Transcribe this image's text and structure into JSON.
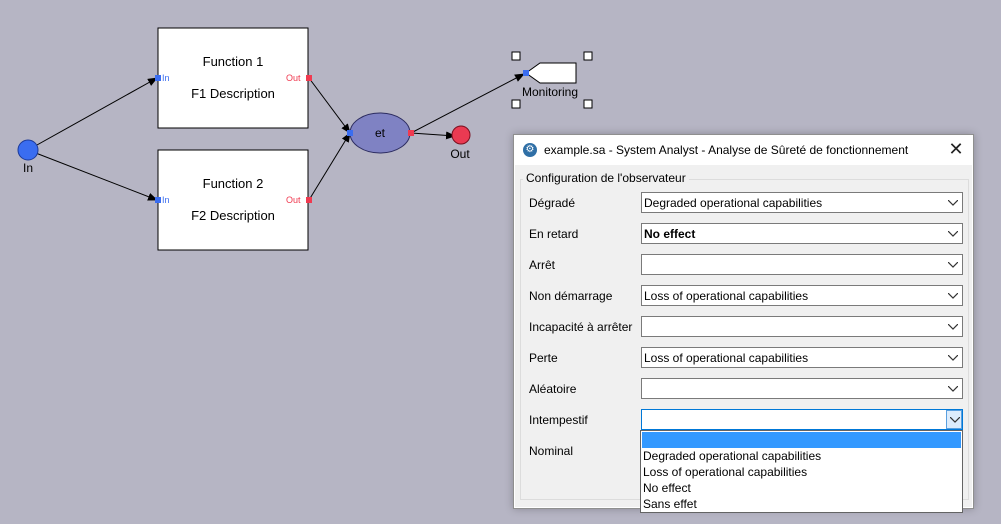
{
  "diagram": {
    "function1": {
      "title": "Function 1",
      "description": "F1 Description",
      "in_label": "In",
      "out_label": "Out"
    },
    "function2": {
      "title": "Function 2",
      "description": "F2 Description",
      "in_label": "In",
      "out_label": "Out"
    },
    "input_node": {
      "label": "In"
    },
    "and_node": {
      "label": "et"
    },
    "output_node": {
      "label": "Out"
    },
    "monitoring": {
      "label": "Monitoring"
    },
    "colors": {
      "in_port": "#3a6df0",
      "out_port": "#f03a50",
      "and_node": "#7f82c3",
      "input_circle": "#3a6df0",
      "output_circle": "#ea3a52"
    }
  },
  "dialog": {
    "title": "example.sa - System Analyst - Analyse de Sûreté de fonctionnement",
    "close_glyph": "✕",
    "group_title": "Configuration de l'observateur",
    "rows": [
      {
        "label": "Dégradé",
        "value": "Degraded operational capabilities",
        "bold": false
      },
      {
        "label": "En retard",
        "value": "No effect",
        "bold": true
      },
      {
        "label": "Arrêt",
        "value": "",
        "bold": false
      },
      {
        "label": "Non démarrage",
        "value": "Loss of operational capabilities",
        "bold": false
      },
      {
        "label": "Incapacité à arrêter",
        "value": "",
        "bold": false
      },
      {
        "label": "Perte",
        "value": "Loss of operational capabilities",
        "bold": false
      },
      {
        "label": "Aléatoire",
        "value": "",
        "bold": false
      },
      {
        "label": "Intempestif",
        "value": "",
        "bold": false,
        "open": true
      },
      {
        "label": "Nominal"
      }
    ],
    "dropdown_options": [
      "",
      "Degraded operational capabilities",
      "Loss of operational capabilities",
      "No effect",
      "Sans effet"
    ]
  }
}
